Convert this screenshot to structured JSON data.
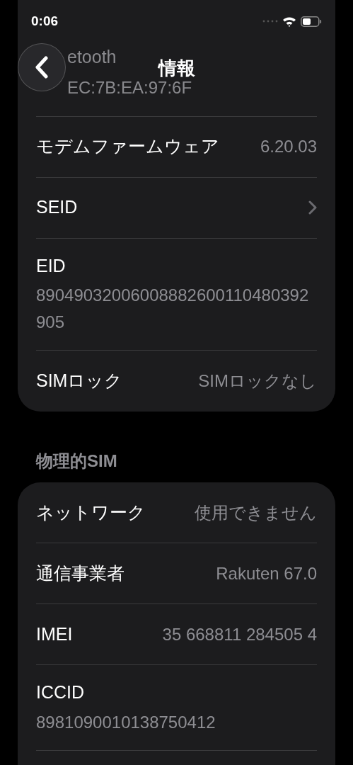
{
  "status_bar": {
    "time": "0:06"
  },
  "header": {
    "title": "情報"
  },
  "sections": [
    {
      "rows": [
        {
          "kind": "behind-header",
          "label": "etooth",
          "value": "EC:7B:EA:97:6F"
        },
        {
          "kind": "value",
          "label": "モデムファームウェア",
          "value": "6.20.03"
        },
        {
          "kind": "link",
          "label": "SEID"
        },
        {
          "kind": "stacked",
          "label": "EID",
          "value": "89049032006008882600110480392905"
        },
        {
          "kind": "value",
          "label": "SIMロック",
          "value": "SIMロックなし"
        }
      ]
    },
    {
      "heading": "物理的SIM",
      "rows": [
        {
          "kind": "value",
          "label": "ネットワーク",
          "value": "使用できません"
        },
        {
          "kind": "value",
          "label": "通信事業者",
          "value": "Rakuten 67.0"
        },
        {
          "kind": "value",
          "label": "IMEI",
          "value": "35 668811 284505 4"
        },
        {
          "kind": "stacked",
          "label": "ICCID",
          "value": "8981090010138750412"
        }
      ]
    }
  ]
}
